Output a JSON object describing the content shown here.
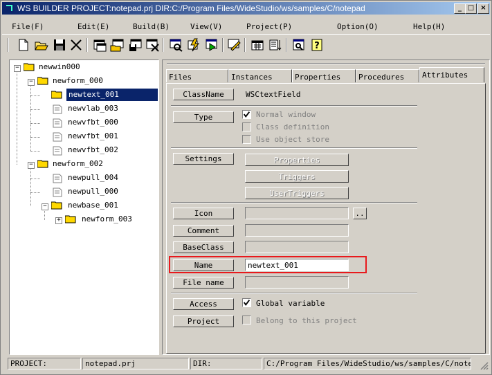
{
  "window": {
    "title": "WS BUILDER PROJECT:notepad.prj DIR:C:/Program Files/WideStudio/ws/samples/C/notepad",
    "controls": [
      "_",
      "□",
      "×"
    ]
  },
  "menu": [
    "File(F)",
    "Edit(E)",
    "Build(B)",
    "View(V)",
    "Project(P)",
    "Option(O)",
    "Help(H)"
  ],
  "toolbar": [
    "new-file-icon",
    "open-folder-icon",
    "save-disk-icon",
    "cut-icon",
    "new-window-icon",
    "open-window-icon",
    "save-window-icon",
    "close-window-icon",
    "preview-icon",
    "build-icon",
    "execute-icon",
    "edit-icon",
    "calendar-icon",
    "list-sort-icon",
    "inspect-icon",
    "help-icon"
  ],
  "tree": {
    "root": "newwin000",
    "form_000": "newform_000",
    "text_001": "newtext_001",
    "vlab_003": "newvlab_003",
    "vfbt_000": "newvfbt_000",
    "vfbt_001": "newvfbt_001",
    "vfbt_002": "newvfbt_002",
    "form_002": "newform_002",
    "pull_004": "newpull_004",
    "pull_000": "newpull_000",
    "base_001": "newbase_001",
    "form_003": "newform_003"
  },
  "tabs": [
    "Files",
    "Instances",
    "Properties",
    "Procedures",
    "Attributes"
  ],
  "attributes": {
    "classname_label": "ClassName",
    "classname_value": "WSCtextField",
    "type_label": "Type",
    "type_normal": "Normal window",
    "type_classdef": "Class definition",
    "type_objstore": "Use object store",
    "settings_label": "Settings",
    "properties_btn": "Properties",
    "triggers_btn": "Triggers",
    "usertriggers_btn": "UserTriggers",
    "icon_label": "Icon",
    "icon_browse": "..",
    "comment_label": "Comment",
    "baseclass_label": "BaseClass",
    "name_label": "Name",
    "name_value": "newtext_001",
    "filename_label": "File name",
    "access_label": "Access",
    "global_var": "Global variable",
    "project_label": "Project",
    "belong_project": "Belong to this project"
  },
  "status": {
    "project_label": "PROJECT:",
    "project_value": "notepad.prj",
    "dir_label": "DIR:",
    "dir_value": "C:/Program Files/WideStudio/ws/samples/C/notepad"
  },
  "colors": {
    "selection": "#0a246a",
    "highlight_box": "#e8191c",
    "face": "#d4d0c8"
  }
}
